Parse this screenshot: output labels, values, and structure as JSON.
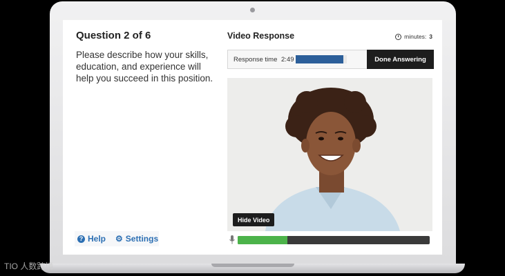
{
  "question": {
    "title": "Question 2 of 6",
    "text": "Please describe how your skills, education, and experience will help you succeed in this position."
  },
  "links": {
    "help": "Help",
    "settings": "Settings"
  },
  "video_panel": {
    "title": "Video Response",
    "minutes_label": "minutes:",
    "minutes_value": "3",
    "response_label": "Response time",
    "response_time": "2:49",
    "response_progress": 0.93,
    "done_button": "Done Answering",
    "hide_button": "Hide Video",
    "audio_level": 0.26
  },
  "watermark": "TIO 人数跨境",
  "colors": {
    "accent_blue": "#2c6fb3",
    "progress_blue": "#2c5f9a",
    "audio_green": "#4cb34a",
    "dark_button": "#1d1d1d"
  }
}
